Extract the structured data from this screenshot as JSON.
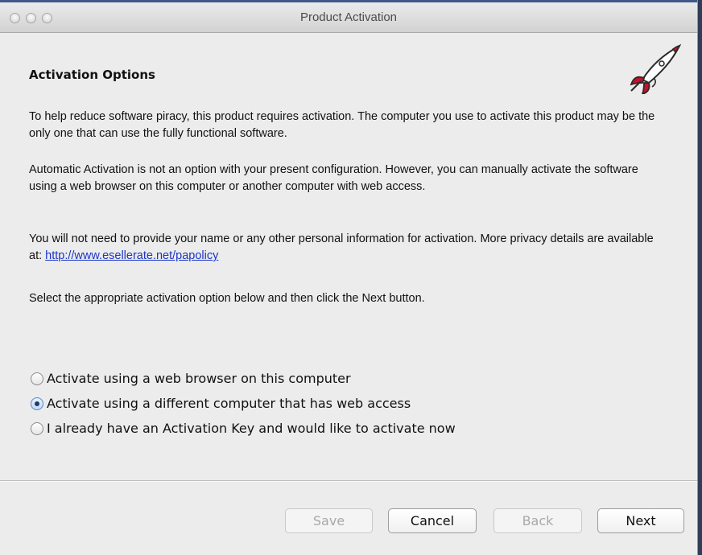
{
  "window": {
    "title": "Product Activation"
  },
  "heading": "Activation Options",
  "paragraphs": {
    "p1": "To help reduce software piracy, this product requires activation. The computer you use to activate this product may be the only one that can use the fully functional software.",
    "p2": "Automatic Activation is not an option with your present configuration. However, you can manually activate the software using a web browser on this computer or another computer with web access.",
    "p3_text": "You will not need to provide your name or any other personal information for activation. More privacy details are available at: ",
    "p3_link": "http://www.esellerate.net/papolicy",
    "p4": "Select the appropriate activation option below and then click the Next button."
  },
  "options": [
    {
      "label": "Activate using a web browser on this computer",
      "selected": false
    },
    {
      "label": "Activate using a different computer that has web access",
      "selected": true
    },
    {
      "label": "I already have an Activation Key and would like to activate now",
      "selected": false
    }
  ],
  "buttons": {
    "save": {
      "label": "Save",
      "enabled": false
    },
    "cancel": {
      "label": "Cancel",
      "enabled": true
    },
    "back": {
      "label": "Back",
      "enabled": false
    },
    "next": {
      "label": "Next",
      "enabled": true
    }
  },
  "icons": {
    "logo": "rocket-icon"
  },
  "colors": {
    "link": "#1a35c8",
    "selected_radio": "#1e3b6b"
  }
}
